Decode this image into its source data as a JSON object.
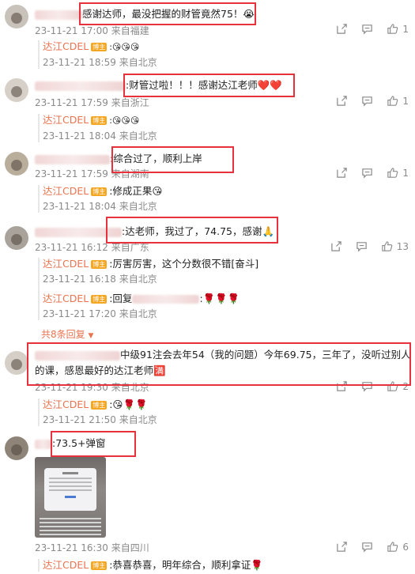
{
  "comments": [
    {
      "text": "感谢达师，最没把握的财管竟然75！😭",
      "time": "23-11-21 17:00",
      "location": "来自福建",
      "comment_count": "",
      "like_count": "1",
      "replies": [
        {
          "name": "达江CDEL",
          "badge": "博主",
          "text": ":😘😘😘",
          "time": "23-11-21 18:59",
          "location": "来自北京"
        }
      ]
    },
    {
      "text": ":财管过啦！！！感谢达江老师❤️❤️",
      "time": "23-11-21 17:59",
      "location": "来自浙江",
      "comment_count": "",
      "like_count": "1",
      "replies": [
        {
          "name": "达江CDEL",
          "badge": "博主",
          "text": ":😘😘😘",
          "time": "23-11-21 18:04",
          "location": "来自北京"
        }
      ]
    },
    {
      "text": ":综合过了，顺利上岸",
      "time": "23-11-21 17:59",
      "location": "来自湖南",
      "comment_count": "",
      "like_count": "1",
      "replies": [
        {
          "name": "达江CDEL",
          "badge": "博主",
          "text": ":修成正果😘",
          "time": "23-11-21 18:04",
          "location": "来自北京"
        }
      ]
    },
    {
      "text": ":达老师，我过了，74.75，感谢🙏",
      "time": "23-11-21 16:12",
      "location": "来自广东",
      "comment_count": "",
      "like_count": "13",
      "replies": [
        {
          "name": "达江CDEL",
          "badge": "博主",
          "text": ":厉害厉害，这个分数很不错[奋斗]",
          "time": "23-11-21 16:18",
          "location": "来自北京"
        },
        {
          "name": "达江CDEL",
          "badge": "博主",
          "text": ":回复",
          "text_after": ":🌹🌹🌹",
          "time": "23-11-21 17:20",
          "location": "来自北京"
        }
      ],
      "more_replies": "共8条回复"
    },
    {
      "text_line1": "中级91注会去年54（我的问题）今年69.75，三年了，没听过别人",
      "text_line2": "的课，感恩最好的达江老师🈵",
      "time": "23-11-21 19:30",
      "location": "来自北京",
      "comment_count": "",
      "like_count": "2",
      "replies": [
        {
          "name": "达江CDEL",
          "badge": "博主",
          "text": ":😘🌹🌹",
          "time": "23-11-21 21:50",
          "location": "来自北京"
        }
      ]
    },
    {
      "text": ":73.5+弹窗",
      "time": "23-11-21 16:30",
      "location": "来自四川",
      "comment_count": "",
      "like_count": "6",
      "replies": [
        {
          "name": "达江CDEL",
          "badge": "博主",
          "text": ":恭喜恭喜，明年综合，顺利拿证🌹"
        }
      ]
    }
  ],
  "icons": [
    "share-icon",
    "comment-icon",
    "like-icon"
  ],
  "colors": {
    "highlight_box": "#e6323c",
    "author_name": "#eb7350",
    "meta": "#8a8a8a"
  }
}
